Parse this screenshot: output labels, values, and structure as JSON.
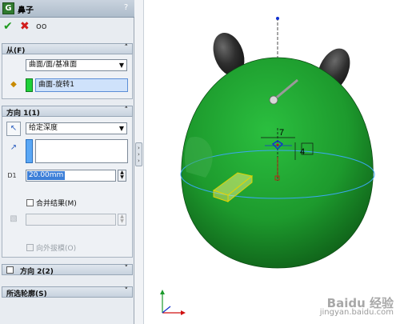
{
  "feature": {
    "title": "鼻子",
    "help": "?",
    "icon_label": "G"
  },
  "actions": {
    "ok_icon": "checkmark-icon",
    "cancel_icon": "x-icon",
    "preview_icon": "glasses-icon"
  },
  "from_section": {
    "header": "从(F)",
    "start_condition": "曲面/面/基准面",
    "selected_entity": "曲面-旋转1"
  },
  "direction1": {
    "header": "方向 1(1)",
    "end_condition": "给定深度",
    "depth_value": "20.00mm",
    "depth_icon_label": "D1",
    "merge_result": "合并结果(M)",
    "draft_outward": "向外拔模(O)"
  },
  "direction2": {
    "header": "方向 2(2)"
  },
  "selected_contours": {
    "header": "所选轮廓(S)"
  },
  "sketch": {
    "dim1": "7",
    "dim2": "4"
  },
  "watermark": {
    "brand": "Baidu 经验",
    "url": "jingyan.baidu.com"
  },
  "colors": {
    "model_green": "#1f9a2e",
    "ear_dark": "#2a2a2a",
    "accent_blue": "#3d7fd8"
  }
}
